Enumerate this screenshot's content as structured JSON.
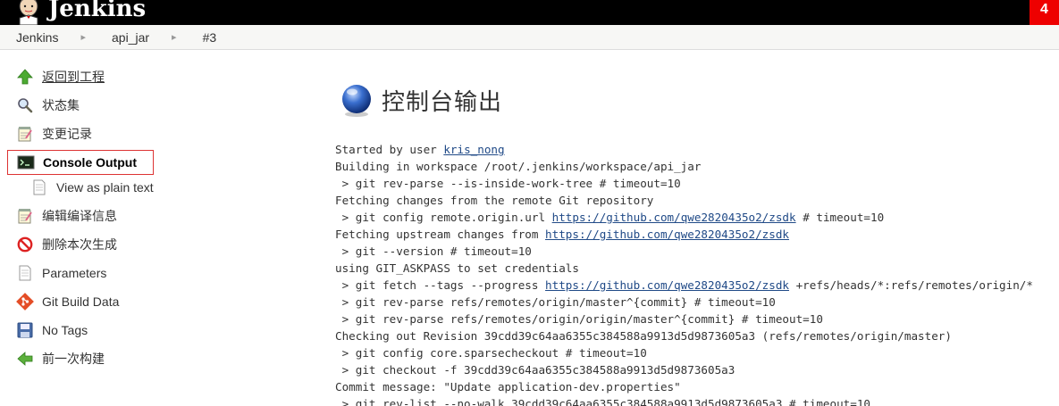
{
  "header": {
    "app_title": "Jenkins",
    "notification_count": "4"
  },
  "breadcrumbs": [
    {
      "label": "Jenkins"
    },
    {
      "label": "api_jar"
    },
    {
      "label": "#3"
    }
  ],
  "sidebar": {
    "items": [
      {
        "label": "返回到工程",
        "icon": "up-arrow-icon"
      },
      {
        "label": "状态集",
        "icon": "magnifier-icon"
      },
      {
        "label": "变更记录",
        "icon": "notepad-icon"
      },
      {
        "label": "Console Output",
        "icon": "terminal-icon"
      },
      {
        "label": "View as plain text",
        "icon": "document-icon"
      },
      {
        "label": "编辑编译信息",
        "icon": "notepad-icon"
      },
      {
        "label": "删除本次生成",
        "icon": "no-entry-icon"
      },
      {
        "label": "Parameters",
        "icon": "document-icon"
      },
      {
        "label": "Git Build Data",
        "icon": "git-icon"
      },
      {
        "label": "No Tags",
        "icon": "floppy-disk-icon"
      },
      {
        "label": "前一次构建",
        "icon": "left-arrow-icon"
      }
    ]
  },
  "main": {
    "title": "控制台输出",
    "console": {
      "user_link": "kris_nong",
      "repo_url": "https://github.com/qwe2820435o2/zsdk",
      "lines": [
        {
          "pre": "Started by user ",
          "link": "kris_nong",
          "post": ""
        },
        {
          "pre": "Building in workspace /root/.jenkins/workspace/api_jar"
        },
        {
          "pre": " > git rev-parse --is-inside-work-tree # timeout=10"
        },
        {
          "pre": "Fetching changes from the remote Git repository"
        },
        {
          "pre": " > git config remote.origin.url ",
          "link": "https://github.com/qwe2820435o2/zsdk",
          "post": " # timeout=10"
        },
        {
          "pre": "Fetching upstream changes from ",
          "link": "https://github.com/qwe2820435o2/zsdk",
          "post": ""
        },
        {
          "pre": " > git --version # timeout=10"
        },
        {
          "pre": "using GIT_ASKPASS to set credentials"
        },
        {
          "pre": " > git fetch --tags --progress ",
          "link": "https://github.com/qwe2820435o2/zsdk",
          "post": " +refs/heads/*:refs/remotes/origin/*"
        },
        {
          "pre": " > git rev-parse refs/remotes/origin/master^{commit} # timeout=10"
        },
        {
          "pre": " > git rev-parse refs/remotes/origin/origin/master^{commit} # timeout=10"
        },
        {
          "pre": "Checking out Revision 39cdd39c64aa6355c384588a9913d5d9873605a3 (refs/remotes/origin/master)"
        },
        {
          "pre": " > git config core.sparsecheckout # timeout=10"
        },
        {
          "pre": " > git checkout -f 39cdd39c64aa6355c384588a9913d5d9873605a3"
        },
        {
          "pre": "Commit message: \"Update application-dev.properties\""
        },
        {
          "pre": " > git rev-list --no-walk 39cdd39c64aa6355c384588a9913d5d9873605a3 # timeout=10"
        }
      ]
    }
  },
  "colors": {
    "link": "#204a87",
    "active_border": "#dd3333",
    "badge": "#ee0000"
  }
}
